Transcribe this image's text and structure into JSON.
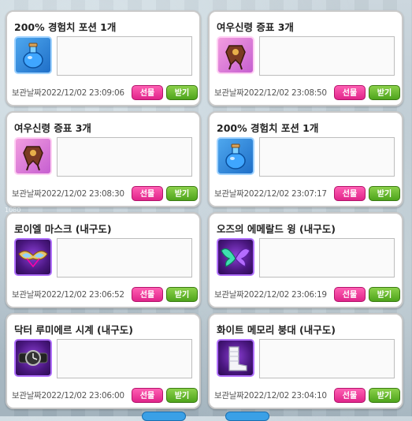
{
  "labels": {
    "date_prefix": "보관날짜",
    "gift_button": "선물",
    "receive_button": "받기"
  },
  "overlay_text": "1080",
  "colors": {
    "gift": "#e0248a",
    "receive": "#4ea41c",
    "card_border": "#c9c9c9"
  },
  "items": [
    {
      "title": "200% 경험치 포션 1개",
      "icon": "potion-icon",
      "icon_bg": "blue",
      "date": "2022/12/02 23:09:06"
    },
    {
      "title": "여우신령 증표 3개",
      "icon": "fox-token-icon",
      "icon_bg": "pink",
      "date": "2022/12/02 23:08:50"
    },
    {
      "title": "여우신령 증표 3개",
      "icon": "fox-token-icon",
      "icon_bg": "pink",
      "date": "2022/12/02 23:08:30"
    },
    {
      "title": "200% 경험치 포션 1개",
      "icon": "potion-icon",
      "icon_bg": "blue",
      "date": "2022/12/02 23:07:17"
    },
    {
      "title": "로이엘 마스크 (내구도)",
      "icon": "mask-icon",
      "icon_bg": "purple",
      "date": "2022/12/02 23:06:52"
    },
    {
      "title": "오즈의 에메랄드 윙 (내구도)",
      "icon": "emerald-wing-icon",
      "icon_bg": "purple",
      "date": "2022/12/02 23:06:19"
    },
    {
      "title": "닥터 루미에르 시계 (내구도)",
      "icon": "watch-icon",
      "icon_bg": "purple",
      "date": "2022/12/02 23:06:00"
    },
    {
      "title": "화이트 메모리 붕대 (내구도)",
      "icon": "bandage-icon",
      "icon_bg": "purple",
      "date": "2022/12/02 23:04:10"
    }
  ]
}
